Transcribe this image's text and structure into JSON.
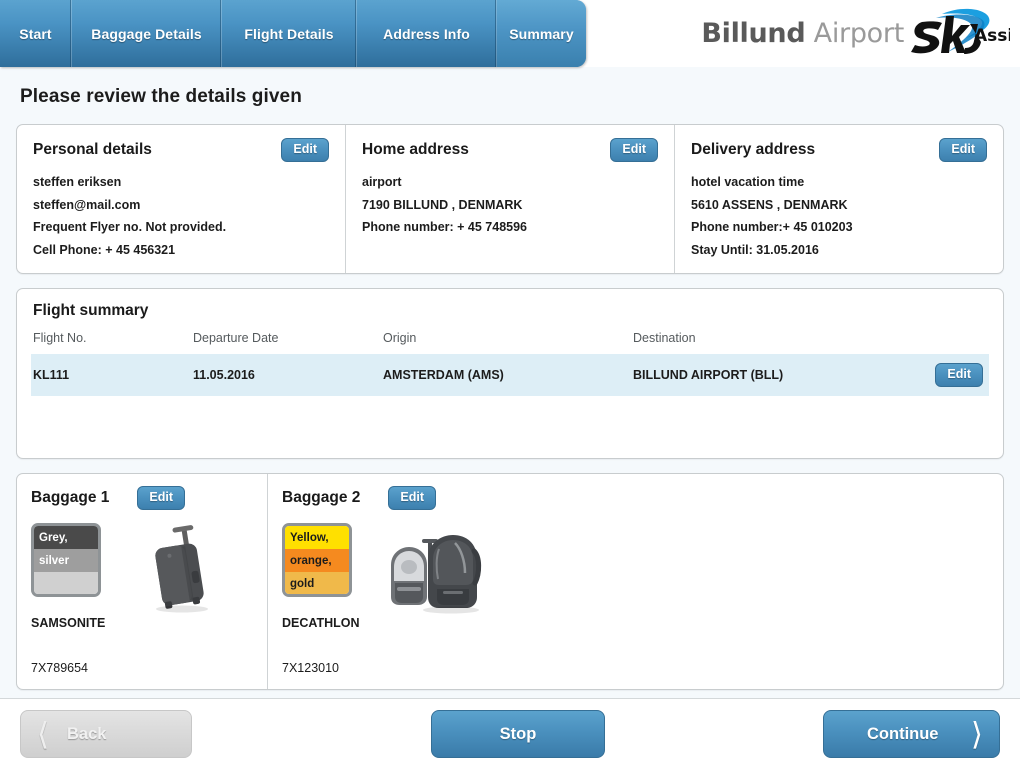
{
  "header": {
    "tabs": [
      {
        "label": "Start",
        "active": false
      },
      {
        "label": "Baggage Details",
        "active": false
      },
      {
        "label": "Flight Details",
        "active": false
      },
      {
        "label": "Address Info",
        "active": false
      },
      {
        "label": "Summary",
        "active": true
      }
    ],
    "logo": {
      "brand_bold": "Billund",
      "brand_light": "Airport",
      "mark_sky": "Sky",
      "mark_assist": "Assist"
    }
  },
  "page": {
    "title": "Please review the details given"
  },
  "personal_details": {
    "title": "Personal details",
    "edit_label": "Edit",
    "lines": [
      "steffen eriksen",
      "steffen@mail.com",
      "Frequent Flyer no. Not provided.",
      "Cell Phone: + 45 456321"
    ]
  },
  "home_address": {
    "title": "Home address",
    "edit_label": "Edit",
    "lines": [
      "airport",
      "7190   BILLUND , DENMARK",
      "Phone number: + 45 748596"
    ]
  },
  "delivery_address": {
    "title": "Delivery address",
    "edit_label": "Edit",
    "lines": [
      "hotel vacation time",
      "5610   ASSENS , DENMARK",
      "Phone number:+ 45 010203",
      "Stay Until: 31.05.2016"
    ]
  },
  "flight_summary": {
    "title": "Flight summary",
    "columns": [
      "Flight No.",
      "Departure Date",
      "Origin",
      "Destination"
    ],
    "rows": [
      {
        "flight_no": "KL111",
        "departure_date": "11.05.2016",
        "origin": "AMSTERDAM (AMS)",
        "destination": "BILLUND AIRPORT (BLL)",
        "edit_label": "Edit",
        "selected": true
      }
    ]
  },
  "baggage": [
    {
      "title": "Baggage 1",
      "edit_label": "Edit",
      "colors": [
        {
          "label": "Grey,",
          "hex": "#4a4a4a",
          "text_hex": "#ffffff"
        },
        {
          "label": "silver",
          "hex": "#9e9e9e",
          "text_hex": "#ffffff"
        },
        {
          "label": "",
          "hex": "#d0d0d0",
          "text_hex": "#333333"
        }
      ],
      "brand": "SAMSONITE",
      "tag": "7X789654",
      "image": "suitcase-icon"
    },
    {
      "title": "Baggage 2",
      "edit_label": "Edit",
      "colors": [
        {
          "label": "Yellow,",
          "hex": "#ffe000",
          "text_hex": "#1c1c1c"
        },
        {
          "label": "orange,",
          "hex": "#f58a1f",
          "text_hex": "#1c1c1c"
        },
        {
          "label": "gold",
          "hex": "#f0b94a",
          "text_hex": "#1c1c1c"
        }
      ],
      "brand": "DECATHLON",
      "tag": "7X123010",
      "image": "backpack-icon"
    }
  ],
  "footer": {
    "back_label": "Back",
    "stop_label": "Stop",
    "continue_label": "Continue",
    "back_disabled": true
  },
  "colors": {
    "accent_blue": "#4a90be",
    "tab_blue": "#3b7fae",
    "row_highlight": "#ddeef6",
    "page_bg": "#f5f9fc",
    "card_border": "#c8ccce"
  }
}
